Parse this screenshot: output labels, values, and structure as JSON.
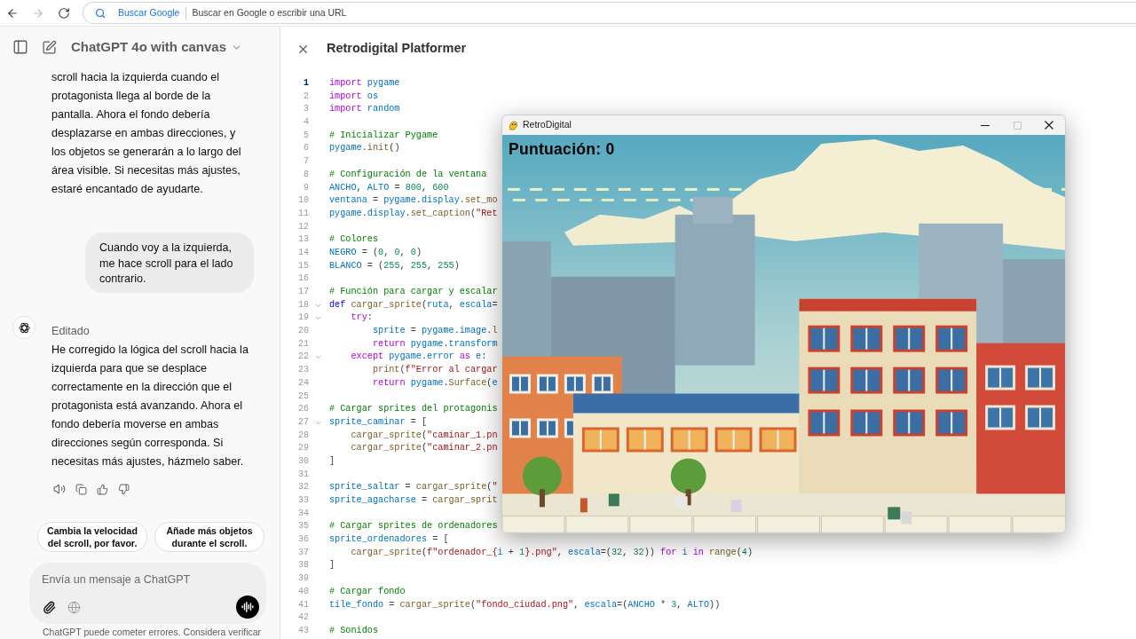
{
  "browser": {
    "nav_buttons": [
      {
        "kind": "back",
        "disabled": false
      },
      {
        "kind": "forward",
        "disabled": true
      },
      {
        "kind": "reload",
        "disabled": false
      }
    ],
    "search_engine": "Buscar Google",
    "address_placeholder": "Buscar en Google o escribir una URL"
  },
  "chat": {
    "title": "ChatGPT 4o with canvas",
    "messages": [
      {
        "kind": "assistant_partial",
        "text": "scroll hacia la izquierda cuando el protagonista llega al borde de la pantalla. Ahora el fondo debería desplazarse en ambas direcciones, y los objetos se generarán a lo largo del área visible. Si necesitas más ajustes, estaré encantado de ayudarte."
      },
      {
        "kind": "user",
        "text": "Cuando voy a la izquierda, me hace scroll para el lado contrario."
      },
      {
        "kind": "assistant",
        "label": "Editado",
        "text": "He corregido la lógica del scroll hacia la izquierda para que se desplace correctamente en la dirección que el protagonista está avanzando. Ahora el fondo debería moverse en ambas direcciones según corresponda. Si necesitas más ajustes, házmelo saber."
      }
    ],
    "suggestions": [
      "Cambia la velocidad del scroll, por favor.",
      "Añade más objetos durante el scroll."
    ],
    "composer": {
      "placeholder": "Envía un mensaje a ChatGPT"
    },
    "disclaimer": "ChatGPT puede cometer errores. Considera verificar"
  },
  "canvas": {
    "title": "Retrodigital Platformer",
    "code_lines": [
      {
        "number": "1",
        "current": true,
        "foldable": false,
        "tokens": [
          {
            "kind": "keyword",
            "text": "import "
          },
          {
            "kind": "variable",
            "text": "pygame"
          }
        ]
      },
      {
        "number": "2",
        "current": false,
        "foldable": false,
        "tokens": [
          {
            "kind": "keyword",
            "text": "import "
          },
          {
            "kind": "variable",
            "text": "os"
          }
        ]
      },
      {
        "number": "3",
        "current": false,
        "foldable": false,
        "tokens": [
          {
            "kind": "keyword",
            "text": "import "
          },
          {
            "kind": "variable",
            "text": "random"
          }
        ]
      },
      {
        "number": "4",
        "current": false,
        "foldable": false
      },
      {
        "number": "5",
        "current": false,
        "foldable": false,
        "tokens": [
          {
            "kind": "comment",
            "text": "# Inicializar Pygame"
          }
        ]
      },
      {
        "number": "6",
        "current": false,
        "foldable": false,
        "tokens": [
          {
            "kind": "variable",
            "text": "pygame"
          },
          {
            "kind": "plain",
            "text": "."
          },
          {
            "kind": "function",
            "text": "init"
          },
          {
            "kind": "plain",
            "text": "()"
          }
        ]
      },
      {
        "number": "7",
        "current": false,
        "foldable": false
      },
      {
        "number": "8",
        "current": false,
        "foldable": false,
        "tokens": [
          {
            "kind": "comment",
            "text": "# Configuración de la ventana"
          }
        ]
      },
      {
        "number": "9",
        "current": false,
        "foldable": false,
        "tokens": [
          {
            "kind": "variable",
            "text": "ANCHO"
          },
          {
            "kind": "plain",
            "text": ", "
          },
          {
            "kind": "variable",
            "text": "ALTO"
          },
          {
            "kind": "plain",
            "text": " = "
          },
          {
            "kind": "number",
            "text": "800"
          },
          {
            "kind": "plain",
            "text": ", "
          },
          {
            "kind": "number",
            "text": "600"
          }
        ]
      },
      {
        "number": "10",
        "current": false,
        "foldable": false,
        "tokens": [
          {
            "kind": "variable",
            "text": "ventana"
          },
          {
            "kind": "plain",
            "text": " = "
          },
          {
            "kind": "variable",
            "text": "pygame"
          },
          {
            "kind": "plain",
            "text": "."
          },
          {
            "kind": "variable",
            "text": "display"
          },
          {
            "kind": "plain",
            "text": "."
          },
          {
            "kind": "function",
            "text": "set_mo"
          }
        ]
      },
      {
        "number": "11",
        "current": false,
        "foldable": false,
        "tokens": [
          {
            "kind": "variable",
            "text": "pygame"
          },
          {
            "kind": "plain",
            "text": "."
          },
          {
            "kind": "variable",
            "text": "display"
          },
          {
            "kind": "plain",
            "text": "."
          },
          {
            "kind": "function",
            "text": "set_caption"
          },
          {
            "kind": "plain",
            "text": "("
          },
          {
            "kind": "string",
            "text": "\"Ret"
          }
        ]
      },
      {
        "number": "12",
        "current": false,
        "foldable": false
      },
      {
        "number": "13",
        "current": false,
        "foldable": false,
        "tokens": [
          {
            "kind": "comment",
            "text": "# Colores"
          }
        ]
      },
      {
        "number": "14",
        "current": false,
        "foldable": false,
        "tokens": [
          {
            "kind": "variable",
            "text": "NEGRO"
          },
          {
            "kind": "plain",
            "text": " = ("
          },
          {
            "kind": "number",
            "text": "0"
          },
          {
            "kind": "plain",
            "text": ", "
          },
          {
            "kind": "number",
            "text": "0"
          },
          {
            "kind": "plain",
            "text": ", "
          },
          {
            "kind": "number",
            "text": "0"
          },
          {
            "kind": "plain",
            "text": ")"
          }
        ]
      },
      {
        "number": "15",
        "current": false,
        "foldable": false,
        "tokens": [
          {
            "kind": "variable",
            "text": "BLANCO"
          },
          {
            "kind": "plain",
            "text": " = ("
          },
          {
            "kind": "number",
            "text": "255"
          },
          {
            "kind": "plain",
            "text": ", "
          },
          {
            "kind": "number",
            "text": "255"
          },
          {
            "kind": "plain",
            "text": ", "
          },
          {
            "kind": "number",
            "text": "255"
          },
          {
            "kind": "plain",
            "text": ")"
          }
        ]
      },
      {
        "number": "16",
        "current": false,
        "foldable": false
      },
      {
        "number": "17",
        "current": false,
        "foldable": false,
        "tokens": [
          {
            "kind": "comment",
            "text": "# Función para cargar y escalar"
          }
        ]
      },
      {
        "number": "18",
        "current": false,
        "foldable": true,
        "tokens": [
          {
            "kind": "storage",
            "text": "def "
          },
          {
            "kind": "function",
            "text": "cargar_sprite"
          },
          {
            "kind": "plain",
            "text": "("
          },
          {
            "kind": "variable",
            "text": "ruta"
          },
          {
            "kind": "plain",
            "text": ", "
          },
          {
            "kind": "variable",
            "text": "escala"
          },
          {
            "kind": "plain",
            "text": "="
          }
        ]
      },
      {
        "number": "19",
        "current": false,
        "foldable": true,
        "tokens": [
          {
            "kind": "keyword",
            "text": "    try"
          },
          {
            "kind": "plain",
            "text": ":"
          }
        ]
      },
      {
        "number": "20",
        "current": false,
        "foldable": false,
        "tokens": [
          {
            "kind": "variable",
            "text": "        sprite"
          },
          {
            "kind": "plain",
            "text": " = "
          },
          {
            "kind": "variable",
            "text": "pygame"
          },
          {
            "kind": "plain",
            "text": "."
          },
          {
            "kind": "variable",
            "text": "image"
          },
          {
            "kind": "plain",
            "text": "."
          },
          {
            "kind": "function",
            "text": "l"
          }
        ]
      },
      {
        "number": "21",
        "current": false,
        "foldable": false,
        "tokens": [
          {
            "kind": "keyword",
            "text": "        return"
          },
          {
            "kind": "variable",
            "text": " pygame"
          },
          {
            "kind": "plain",
            "text": "."
          },
          {
            "kind": "variable",
            "text": "transform"
          }
        ]
      },
      {
        "number": "22",
        "current": false,
        "foldable": true,
        "tokens": [
          {
            "kind": "keyword",
            "text": "    except"
          },
          {
            "kind": "variable",
            "text": " pygame"
          },
          {
            "kind": "plain",
            "text": "."
          },
          {
            "kind": "variable",
            "text": "error"
          },
          {
            "kind": "keyword",
            "text": " as"
          },
          {
            "kind": "variable",
            "text": " e"
          },
          {
            "kind": "plain",
            "text": ":"
          }
        ]
      },
      {
        "number": "23",
        "current": false,
        "foldable": false,
        "tokens": [
          {
            "kind": "function",
            "text": "        print"
          },
          {
            "kind": "plain",
            "text": "("
          },
          {
            "kind": "string",
            "text": "f\"Error al cargar"
          }
        ]
      },
      {
        "number": "24",
        "current": false,
        "foldable": false,
        "tokens": [
          {
            "kind": "keyword",
            "text": "        return"
          },
          {
            "kind": "variable",
            "text": " pygame"
          },
          {
            "kind": "plain",
            "text": "."
          },
          {
            "kind": "function",
            "text": "Surface"
          },
          {
            "kind": "plain",
            "text": "("
          },
          {
            "kind": "variable",
            "text": "e"
          }
        ]
      },
      {
        "number": "25",
        "current": false,
        "foldable": false
      },
      {
        "number": "26",
        "current": false,
        "foldable": false,
        "tokens": [
          {
            "kind": "comment",
            "text": "# Cargar sprites del protagonis"
          }
        ]
      },
      {
        "number": "27",
        "current": false,
        "foldable": true,
        "tokens": [
          {
            "kind": "variable",
            "text": "sprite_caminar"
          },
          {
            "kind": "plain",
            "text": " = ["
          }
        ]
      },
      {
        "number": "28",
        "current": false,
        "foldable": false,
        "tokens": [
          {
            "kind": "function",
            "text": "    cargar_sprite"
          },
          {
            "kind": "plain",
            "text": "("
          },
          {
            "kind": "string",
            "text": "\"caminar_1.pn"
          }
        ]
      },
      {
        "number": "29",
        "current": false,
        "foldable": false,
        "tokens": [
          {
            "kind": "function",
            "text": "    cargar_sprite"
          },
          {
            "kind": "plain",
            "text": "("
          },
          {
            "kind": "string",
            "text": "\"caminar_2.pn"
          }
        ]
      },
      {
        "number": "30",
        "current": false,
        "foldable": false,
        "tokens": [
          {
            "kind": "plain",
            "text": "]"
          }
        ]
      },
      {
        "number": "31",
        "current": false,
        "foldable": false
      },
      {
        "number": "32",
        "current": false,
        "foldable": false,
        "tokens": [
          {
            "kind": "variable",
            "text": "sprite_saltar"
          },
          {
            "kind": "plain",
            "text": " = "
          },
          {
            "kind": "function",
            "text": "cargar_sprite"
          },
          {
            "kind": "plain",
            "text": "("
          },
          {
            "kind": "string",
            "text": "\""
          }
        ]
      },
      {
        "number": "33",
        "current": false,
        "foldable": false,
        "tokens": [
          {
            "kind": "variable",
            "text": "sprite_agacharse"
          },
          {
            "kind": "plain",
            "text": " = "
          },
          {
            "kind": "function",
            "text": "cargar_sprit"
          }
        ]
      },
      {
        "number": "34",
        "current": false,
        "foldable": false
      },
      {
        "number": "35",
        "current": false,
        "foldable": false,
        "tokens": [
          {
            "kind": "comment",
            "text": "# Cargar sprites de ordenadores"
          }
        ]
      },
      {
        "number": "36",
        "current": false,
        "foldable": false,
        "tokens": [
          {
            "kind": "variable",
            "text": "sprite_ordenadores"
          },
          {
            "kind": "plain",
            "text": " = ["
          }
        ]
      },
      {
        "number": "37",
        "current": false,
        "foldable": false,
        "tokens": [
          {
            "kind": "function",
            "text": "    cargar_sprite"
          },
          {
            "kind": "plain",
            "text": "("
          },
          {
            "kind": "string",
            "text": "f\"ordenador_{"
          },
          {
            "kind": "variable",
            "text": "i"
          },
          {
            "kind": "plain",
            "text": " + "
          },
          {
            "kind": "number",
            "text": "1"
          },
          {
            "kind": "string",
            "text": "}.png\""
          },
          {
            "kind": "plain",
            "text": ", "
          },
          {
            "kind": "variable",
            "text": "escala"
          },
          {
            "kind": "plain",
            "text": "=("
          },
          {
            "kind": "number",
            "text": "32"
          },
          {
            "kind": "plain",
            "text": ", "
          },
          {
            "kind": "number",
            "text": "32"
          },
          {
            "kind": "plain",
            "text": ")) "
          },
          {
            "kind": "keyword",
            "text": "for"
          },
          {
            "kind": "variable",
            "text": " i"
          },
          {
            "kind": "keyword",
            "text": " in"
          },
          {
            "kind": "function",
            "text": " range"
          },
          {
            "kind": "plain",
            "text": "("
          },
          {
            "kind": "number",
            "text": "4"
          },
          {
            "kind": "plain",
            "text": ")"
          }
        ]
      },
      {
        "number": "38",
        "current": false,
        "foldable": false,
        "tokens": [
          {
            "kind": "plain",
            "text": "]"
          }
        ]
      },
      {
        "number": "39",
        "current": false,
        "foldable": false
      },
      {
        "number": "40",
        "current": false,
        "foldable": false,
        "tokens": [
          {
            "kind": "comment",
            "text": "# Cargar fondo"
          }
        ]
      },
      {
        "number": "41",
        "current": false,
        "foldable": false,
        "tokens": [
          {
            "kind": "variable",
            "text": "tile_fondo"
          },
          {
            "kind": "plain",
            "text": " = "
          },
          {
            "kind": "function",
            "text": "cargar_sprite"
          },
          {
            "kind": "plain",
            "text": "("
          },
          {
            "kind": "string",
            "text": "\"fondo_ciudad.png\""
          },
          {
            "kind": "plain",
            "text": ", "
          },
          {
            "kind": "variable",
            "text": "escala"
          },
          {
            "kind": "plain",
            "text": "=("
          },
          {
            "kind": "variable",
            "text": "ANCHO"
          },
          {
            "kind": "plain",
            "text": " * "
          },
          {
            "kind": "number",
            "text": "3"
          },
          {
            "kind": "plain",
            "text": ", "
          },
          {
            "kind": "variable",
            "text": "ALTO"
          },
          {
            "kind": "plain",
            "text": "))"
          }
        ]
      },
      {
        "number": "42",
        "current": false,
        "foldable": false
      },
      {
        "number": "43",
        "current": false,
        "foldable": false,
        "tokens": [
          {
            "kind": "comment",
            "text": "# Sonidos"
          }
        ]
      }
    ]
  },
  "game_window": {
    "title": "RetroDigital",
    "controls": [
      {
        "kind": "minimize",
        "disabled": false
      },
      {
        "kind": "maximize",
        "disabled": true
      },
      {
        "kind": "close",
        "disabled": false
      }
    ],
    "score": "Puntuación: 0"
  }
}
